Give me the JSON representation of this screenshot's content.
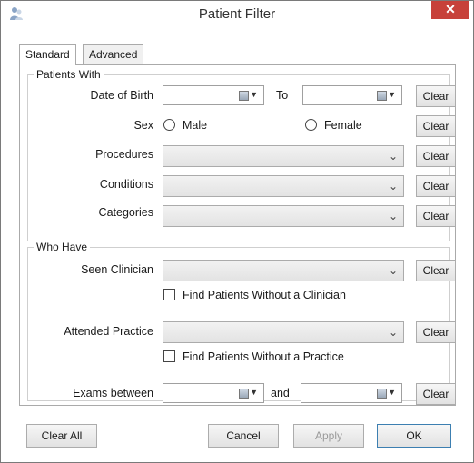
{
  "window": {
    "title": "Patient Filter",
    "close_glyph": "✕"
  },
  "tabs": [
    {
      "label": "Standard",
      "active": true
    },
    {
      "label": "Advanced",
      "active": false
    }
  ],
  "patients_with": {
    "title": "Patients With",
    "date_of_birth_label": "Date of Birth",
    "to_label": "To",
    "sex_label": "Sex",
    "male_label": "Male",
    "female_label": "Female",
    "procedures_label": "Procedures",
    "conditions_label": "Conditions",
    "categories_label": "Categories"
  },
  "who_have": {
    "title": "Who Have",
    "seen_clinician_label": "Seen Clinician",
    "no_clinician_label": "Find Patients Without a Clinician",
    "attended_practice_label": "Attended Practice",
    "no_practice_label": "Find Patients Without a Practice",
    "exams_between_label": "Exams between",
    "and_label": "and"
  },
  "buttons": {
    "clear": "Clear",
    "clear_all": "Clear All",
    "cancel": "Cancel",
    "apply": "Apply",
    "ok": "OK"
  },
  "icons": {
    "app": "patient-filter-app-icon",
    "calendar": "calendar-icon",
    "dropdown": "chevron-down-icon"
  },
  "colors": {
    "close_button": "#c7413a",
    "ok_border": "#3c7fb1",
    "disabled_text": "#9a9a9a"
  }
}
